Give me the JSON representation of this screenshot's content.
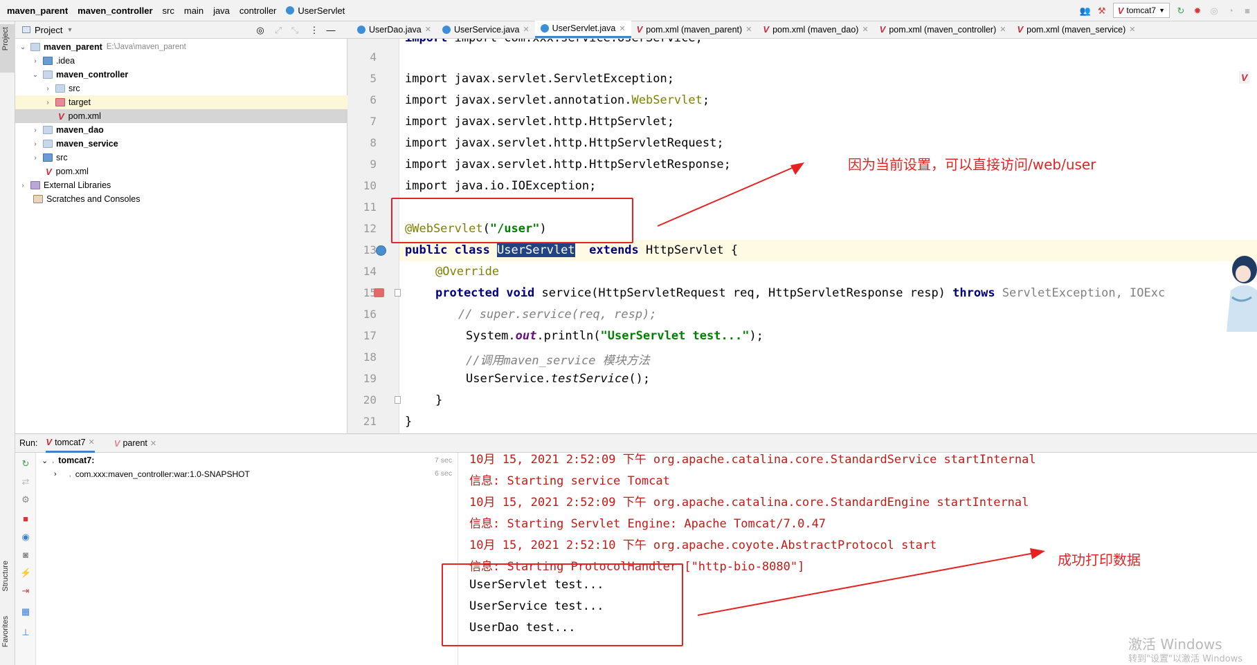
{
  "breadcrumbs": [
    "maven_parent",
    "maven_controller",
    "src",
    "main",
    "java",
    "controller",
    "UserServlet"
  ],
  "run_config": "tomcat7",
  "left_vertical_tabs": {
    "project": "Project",
    "structure": "Structure",
    "favorites": "Favorites"
  },
  "project_panel": {
    "title": "Project",
    "tree": [
      {
        "label": "maven_parent",
        "path": "E:\\Java\\maven_parent"
      },
      {
        "label": ".idea"
      },
      {
        "label": "maven_controller"
      },
      {
        "label": "src"
      },
      {
        "label": "target"
      },
      {
        "label": "pom.xml"
      },
      {
        "label": "maven_dao"
      },
      {
        "label": "maven_service"
      },
      {
        "label": "src"
      },
      {
        "label": "pom.xml"
      },
      {
        "label": "External Libraries"
      },
      {
        "label": "Scratches and Consoles"
      }
    ]
  },
  "editor_tabs": [
    {
      "label": "UserDao.java"
    },
    {
      "label": "UserService.java"
    },
    {
      "label": "UserServlet.java"
    },
    {
      "label": "pom.xml (maven_parent)"
    },
    {
      "label": "pom.xml (maven_dao)"
    },
    {
      "label": "pom.xml (maven_controller)"
    },
    {
      "label": "pom.xml (maven_service)"
    }
  ],
  "code": {
    "line_numbers": [
      "4",
      "5",
      "6",
      "7",
      "8",
      "9",
      "10",
      "11",
      "12",
      "13",
      "14",
      "15",
      "16",
      "17",
      "18",
      "19",
      "20",
      "21"
    ],
    "partial_top": "import com.xxx.service.UserService;",
    "l5": "import javax.servlet.ServletException;",
    "l6a": "import javax.servlet.annotation.",
    "l6b": "WebServlet",
    "l6c": ";",
    "l7": "import javax.servlet.http.HttpServlet;",
    "l8": "import javax.servlet.http.HttpServletRequest;",
    "l9": "import javax.servlet.http.HttpServletResponse;",
    "l10": "import java.io.IOException;",
    "l12a": "@WebServlet",
    "l12b": "(",
    "l12c": "\"/user\"",
    "l12d": ")",
    "l13a": "public class ",
    "l13b": "UserServlet",
    "l13c": "  extends ",
    "l13d": "HttpServlet {",
    "l14": "@Override",
    "l15a": "protected void ",
    "l15b": "service(HttpServletRequest req, HttpServletResponse resp) ",
    "l15c": "throws ",
    "l15d": "ServletException, IOExc",
    "l16": "// super.service(req, resp);",
    "l17a": "System.",
    "l17b": "out",
    "l17c": ".println(",
    "l17d": "\"UserServlet test...\"",
    "l17e": ");",
    "l18": "//调用maven_service 模块方法",
    "l19a": "UserService.",
    "l19b": "testService",
    "l19c": "();",
    "l20": "}",
    "l21": "}"
  },
  "run_panel": {
    "label": "Run:",
    "tabs": [
      {
        "label": "tomcat7"
      },
      {
        "label": "parent"
      }
    ],
    "tree": [
      {
        "label": "tomcat7:",
        "time": "7 sec"
      },
      {
        "label": "com.xxx:maven_controller:war:1.0-SNAPSHOT",
        "time": "6 sec"
      }
    ],
    "console": [
      "10月 15, 2021 2:52:09 下午 org.apache.catalina.core.StandardService startInternal",
      "信息: Starting service Tomcat",
      "10月 15, 2021 2:52:09 下午 org.apache.catalina.core.StandardEngine startInternal",
      "信息: Starting Servlet Engine: Apache Tomcat/7.0.47",
      "10月 15, 2021 2:52:10 下午 org.apache.coyote.AbstractProtocol start",
      "信息: Starting ProtocolHandler [\"http-bio-8080\"]",
      "UserServlet test...",
      "UserService test...",
      "UserDao test..."
    ]
  },
  "annotations": {
    "top": "因为当前设置，可以直接访问/web/user",
    "bottom": "成功打印数据",
    "color": "#e52323"
  },
  "watermark": {
    "line1": "激活 Windows",
    "line2": "转到\"设置\"以激活 Windows"
  }
}
